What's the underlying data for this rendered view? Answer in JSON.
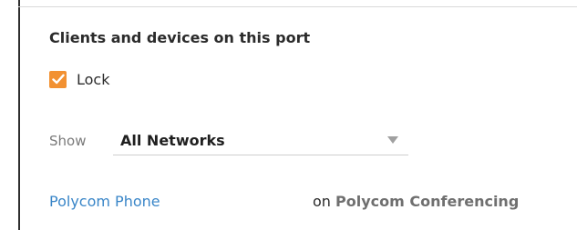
{
  "section": {
    "title": "Clients and devices on this port"
  },
  "lock": {
    "label": "Lock",
    "checked": true,
    "color": "#f29132"
  },
  "filter": {
    "show_label": "Show",
    "selected": "All Networks"
  },
  "client": {
    "device_name": "Polycom Phone",
    "on_text": "on",
    "network_name": "Polycom Conferencing"
  },
  "colors": {
    "link": "#3a86c8",
    "checkbox": "#f29132"
  }
}
